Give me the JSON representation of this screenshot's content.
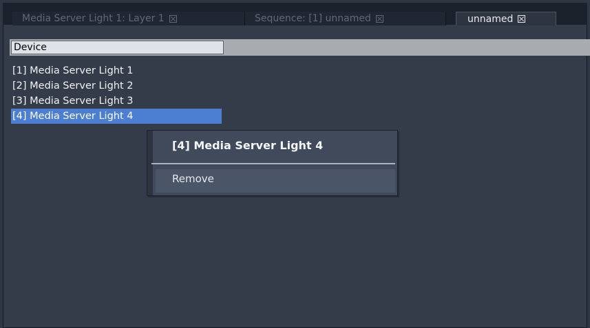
{
  "tabs": [
    {
      "label": "Media Server Light 1: Layer 1",
      "active": false
    },
    {
      "label": "Sequence: [1] unnamed",
      "active": false
    },
    {
      "label": "unnamed",
      "active": true
    }
  ],
  "table": {
    "column_header": "Device",
    "rows": [
      "[1] Media Server Light 1",
      "[2] Media Server Light 2",
      "[3] Media Server Light 3",
      "[4] Media Server Light 4"
    ],
    "selected_index": 3
  },
  "context_menu": {
    "title": "[4] Media Server Light 4",
    "items": [
      "Remove"
    ]
  },
  "icons": {
    "tab_close": "close-box-icon"
  },
  "colors": {
    "selection": "#4c7fd1",
    "background": "#343c49"
  }
}
